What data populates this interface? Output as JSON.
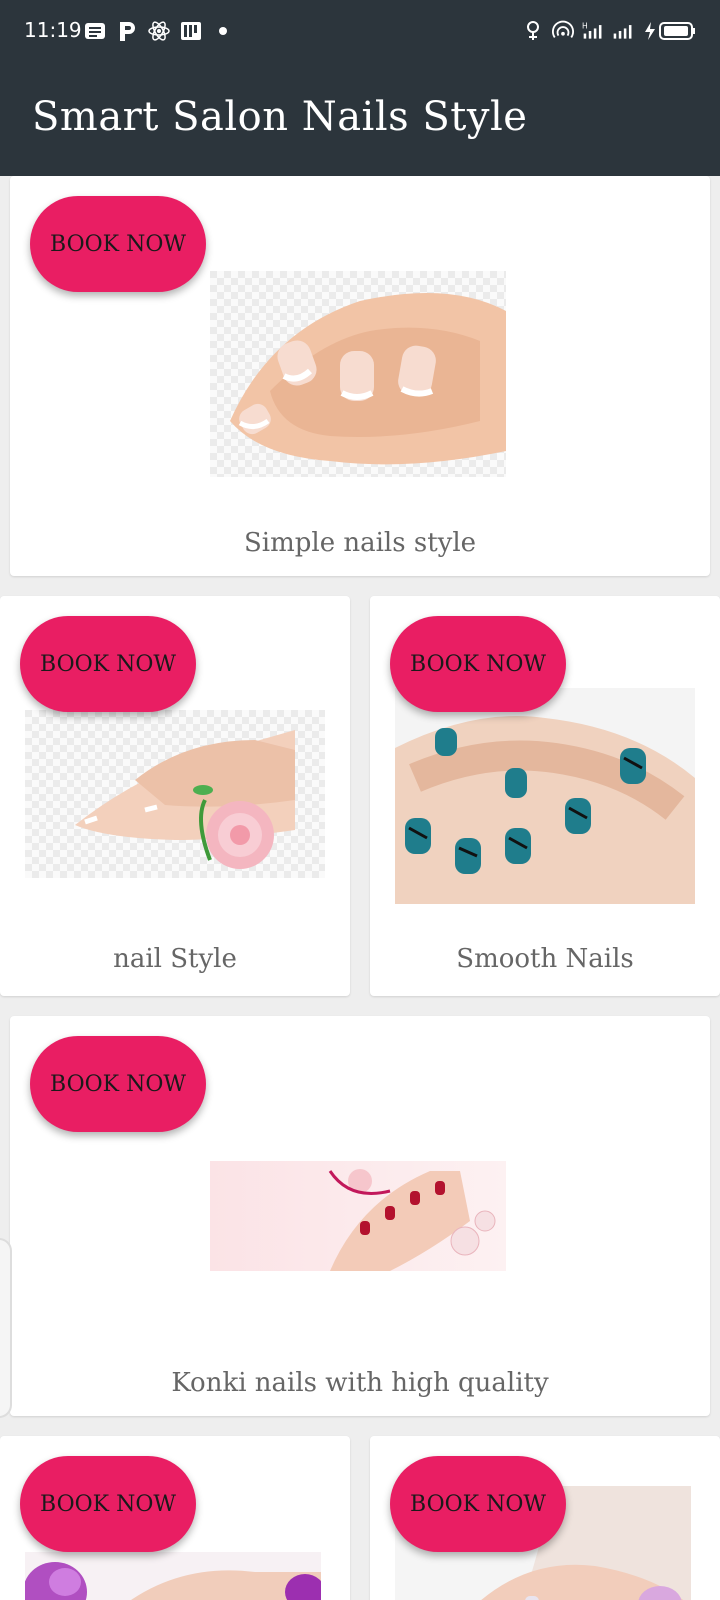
{
  "status": {
    "time": "11:19",
    "left_icons": [
      "news-icon",
      "p-app-icon",
      "atom-icon",
      "pdf-icon",
      "dot-icon"
    ],
    "right_icons": [
      "hotspot-icon",
      "wireless-icon",
      "signal-h-icon",
      "signal-icon",
      "battery-charging-icon"
    ]
  },
  "app_bar": {
    "title": "Smart Salon Nails Style"
  },
  "cards": [
    {
      "button": "BOOK NOW",
      "label": "Simple nails style"
    },
    {
      "button": "BOOK NOW",
      "label": "nail Style"
    },
    {
      "button": "BOOK NOW",
      "label": "Smooth Nails"
    },
    {
      "button": "BOOK NOW",
      "label": "Konki nails with high quality"
    },
    {
      "button": "BOOK NOW",
      "label": ""
    },
    {
      "button": "BOOK NOW",
      "label": ""
    }
  ],
  "colors": {
    "app_bar": "#2c353c",
    "accent": "#e91e63"
  }
}
